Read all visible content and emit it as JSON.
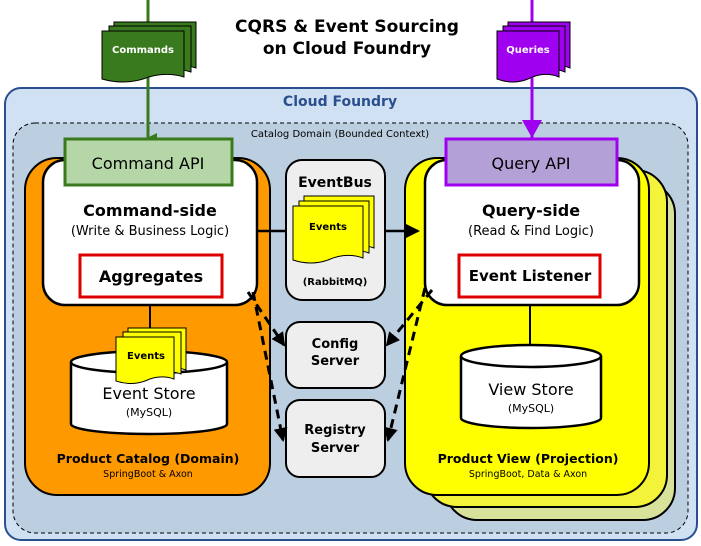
{
  "title": {
    "line1": "CQRS & Event Sourcing",
    "line2": "on Cloud Foundry"
  },
  "inputs": {
    "commands": "Commands",
    "queries": "Queries"
  },
  "platform": {
    "label": "Cloud Foundry"
  },
  "context": {
    "label": "Catalog Domain (Bounded Context)"
  },
  "command_service": {
    "api": "Command API",
    "title": "Command-side",
    "subtitle": "(Write & Business Logic)",
    "component": "Aggregates",
    "store_doc": "Events",
    "store": "Event Store",
    "store_db": "(MySQL)",
    "name": "Product Catalog (Domain)",
    "tech": "SpringBoot & Axon"
  },
  "event_bus": {
    "title": "EventBus",
    "doc": "Events",
    "tech": "(RabbitMQ)"
  },
  "config_server": {
    "line1": "Config",
    "line2": "Server"
  },
  "registry_server": {
    "line1": "Registry",
    "line2": "Server"
  },
  "query_service": {
    "api": "Query API",
    "title": "Query-side",
    "subtitle": "(Read & Find Logic)",
    "component": "Event Listener",
    "store": "View Store",
    "store_db": "(MySQL)",
    "name": "Product View (Projection)",
    "tech": "SpringBoot, Data & Axon"
  },
  "colors": {
    "command_green": "#3a7a1e",
    "query_purple": "#a000f0",
    "command_orange": "#ff9900",
    "query_yellow": "#ffff00",
    "cloud_blue": "#2a4f8f",
    "aggregate_red": "#dd0000"
  }
}
